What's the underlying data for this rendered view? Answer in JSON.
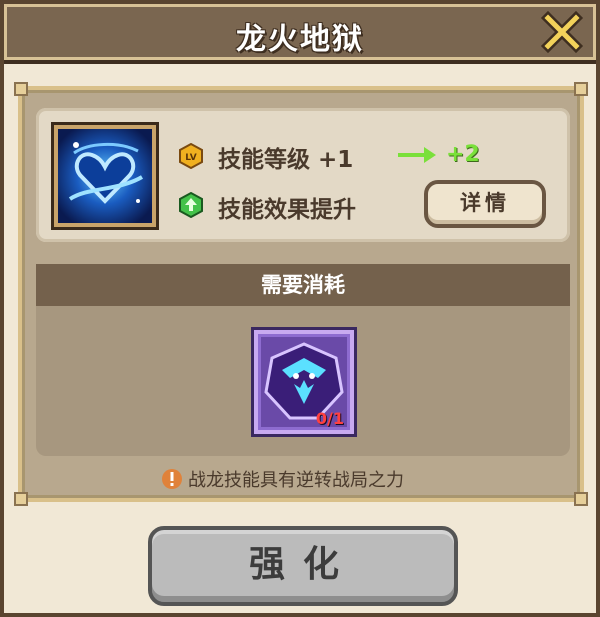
{
  "dialog": {
    "title": "龙火地狱",
    "close_icon": "close-x-icon"
  },
  "skill": {
    "icon": "blue-heart-swirl-skill-icon",
    "level_icon": "lv-badge-icon",
    "level_text": "技能等级 +1",
    "next_level": "+2",
    "effect_icon": "green-up-arrow-icon",
    "effect_text": "技能效果提升",
    "detail_button": "详情"
  },
  "cost": {
    "header": "需要消耗",
    "item_icon": "purple-dragon-crest-icon",
    "item_count": "0/1"
  },
  "tip": {
    "icon": "orange-exclamation-icon",
    "text": "战龙技能具有逆转战局之力"
  },
  "actions": {
    "enhance_button": "强化"
  },
  "colors": {
    "title_bar": "#7a6650",
    "panel_bg": "#f1e8d6",
    "accent_green": "#7ae03a",
    "count_red": "#ff4040",
    "button_gray": "#bbbbbb"
  }
}
